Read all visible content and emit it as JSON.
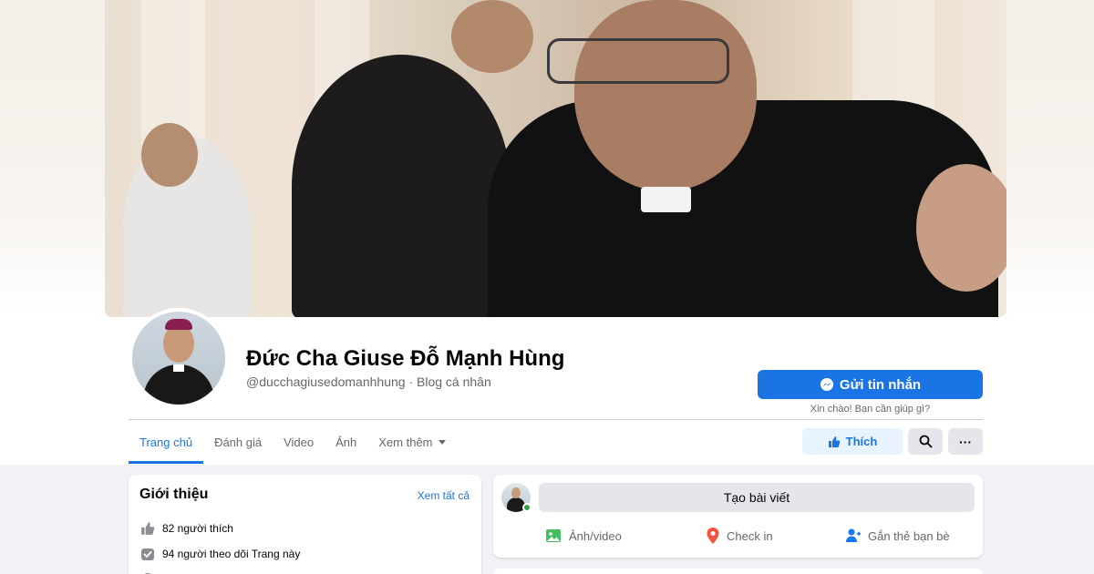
{
  "profile": {
    "name": "Đức Cha Giuse Đỗ Mạnh Hùng",
    "handle_category": "@ducchagiusedomanhhung · Blog cá nhân"
  },
  "actions": {
    "message_label": "Gửi tin nhắn",
    "message_hint": "Xin chào! Bạn cần giúp gì?",
    "like_label": "Thích",
    "more_label": "···"
  },
  "tabs": [
    {
      "label": "Trang chủ",
      "active": true
    },
    {
      "label": "Đánh giá"
    },
    {
      "label": "Video"
    },
    {
      "label": "Ảnh"
    },
    {
      "label": "Xem thêm"
    }
  ],
  "intro": {
    "title": "Giới thiệu",
    "see_all": "Xem tất cả",
    "items": [
      {
        "icon": "thumbs-up-icon",
        "text": "82 người thích"
      },
      {
        "icon": "follow-check-icon",
        "text": "94 người theo dõi Trang này"
      }
    ]
  },
  "composer": {
    "create_post": "Tạo bài viết",
    "photo_video": "Ảnh/video",
    "check_in": "Check in",
    "tag_friends": "Gắn thẻ bạn bè"
  },
  "colors": {
    "accent": "#1b74e4",
    "accent_light": "#e7f3ff",
    "background": "#f0f2f5",
    "secondary_text": "#65676b",
    "online": "#31a24c"
  }
}
